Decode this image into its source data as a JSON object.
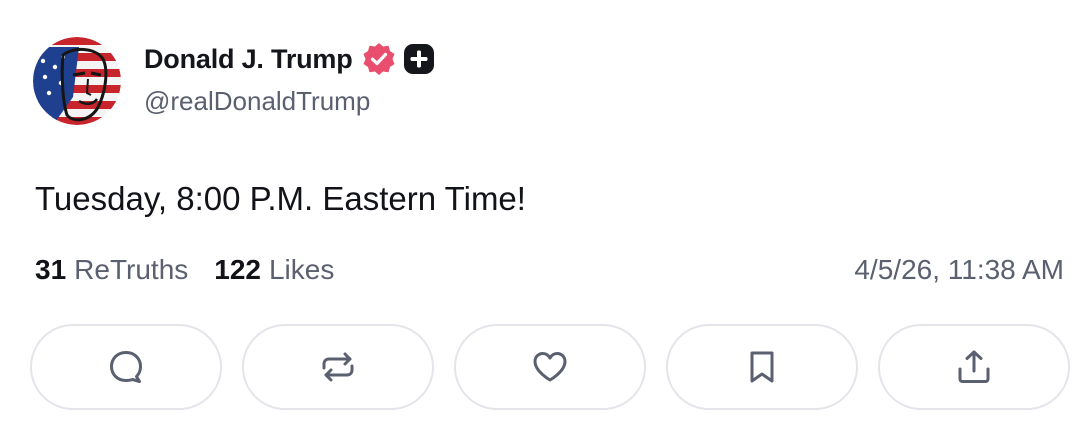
{
  "post": {
    "author": {
      "display_name": "Donald J. Trump",
      "handle": "@realDonaldTrump",
      "verified_icon": "verified-badge-icon",
      "plus_icon": "plus-badge-icon"
    },
    "text": "Tuesday, 8:00 P.M. Eastern Time!",
    "stats": {
      "retruths_count": "31",
      "retruths_label": "ReTruths",
      "likes_count": "122",
      "likes_label": "Likes"
    },
    "timestamp": "4/5/26, 11:38 AM",
    "actions": [
      {
        "name": "reply",
        "icon": "comment-icon"
      },
      {
        "name": "retruth",
        "icon": "repost-icon"
      },
      {
        "name": "like",
        "icon": "heart-icon"
      },
      {
        "name": "bookmark",
        "icon": "bookmark-icon"
      },
      {
        "name": "share",
        "icon": "share-icon"
      }
    ]
  },
  "colors": {
    "text_primary": "#111318",
    "text_secondary": "#5b6070",
    "verified_badge": "#e94e6f",
    "button_border": "#e3e5ea",
    "icon_stroke": "#5b6070"
  }
}
